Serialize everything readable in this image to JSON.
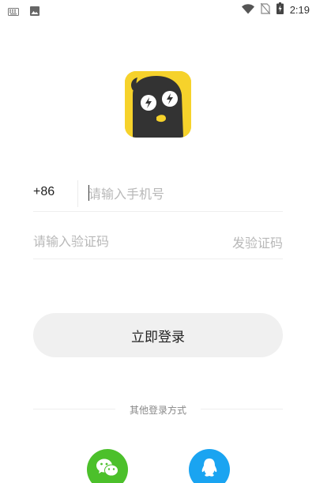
{
  "status_bar": {
    "time": "2:19",
    "icons": [
      "keyboard-icon",
      "image-icon",
      "wifi-icon",
      "no-sim-icon",
      "battery-icon"
    ]
  },
  "logo": {
    "icon": "app-logo-owl"
  },
  "login_form": {
    "country_code": "+86",
    "phone_placeholder": "请输入手机号",
    "code_placeholder": "请输入验证码",
    "send_code_label": "发验证码",
    "login_button_label": "立即登录"
  },
  "other_login": {
    "label": "其他登录方式",
    "options": [
      {
        "name": "wechat",
        "icon": "wechat-icon",
        "color": "#4cc02b"
      },
      {
        "name": "qq",
        "icon": "qq-icon",
        "color": "#1aa4f1"
      }
    ]
  },
  "colors": {
    "logo_yellow": "#f6d22b",
    "logo_dark": "#333333",
    "placeholder": "#b8b8b8",
    "button_bg": "#f0f0f0"
  }
}
